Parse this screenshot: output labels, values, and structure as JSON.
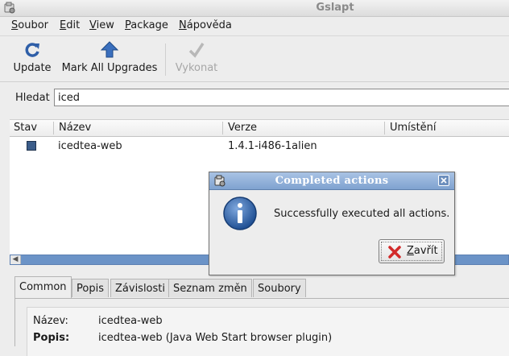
{
  "window": {
    "title": "Gslapt"
  },
  "menu": [
    {
      "first": "S",
      "rest": "oubor"
    },
    {
      "first": "E",
      "rest": "dit"
    },
    {
      "first": "V",
      "rest": "iew"
    },
    {
      "first": "P",
      "rest": "ackage"
    },
    {
      "first": "N",
      "rest": "ápověda"
    }
  ],
  "toolbar": {
    "update": "Update",
    "mark_all": "Mark All Upgrades",
    "execute": "Vykonat"
  },
  "search": {
    "label": "Hledat",
    "value": "iced"
  },
  "table": {
    "columns": [
      "Stav",
      "Název",
      "Verze",
      "Umístění"
    ],
    "rows": [
      {
        "name": "icedtea-web",
        "version": "1.4.1-i486-1alien",
        "location": ""
      }
    ]
  },
  "tabs": [
    "Common",
    "Popis",
    "Závislosti",
    "Seznam změn",
    "Soubory"
  ],
  "details": {
    "name_label": "Název:",
    "name_value": "icedtea-web",
    "desc_label": "Popis:",
    "desc_value": "icedtea-web (Java Web Start browser plugin)"
  },
  "dialog": {
    "title": "Completed actions",
    "message": "Successfully executed all actions.",
    "close_first": "Z",
    "close_rest": "avřít"
  }
}
